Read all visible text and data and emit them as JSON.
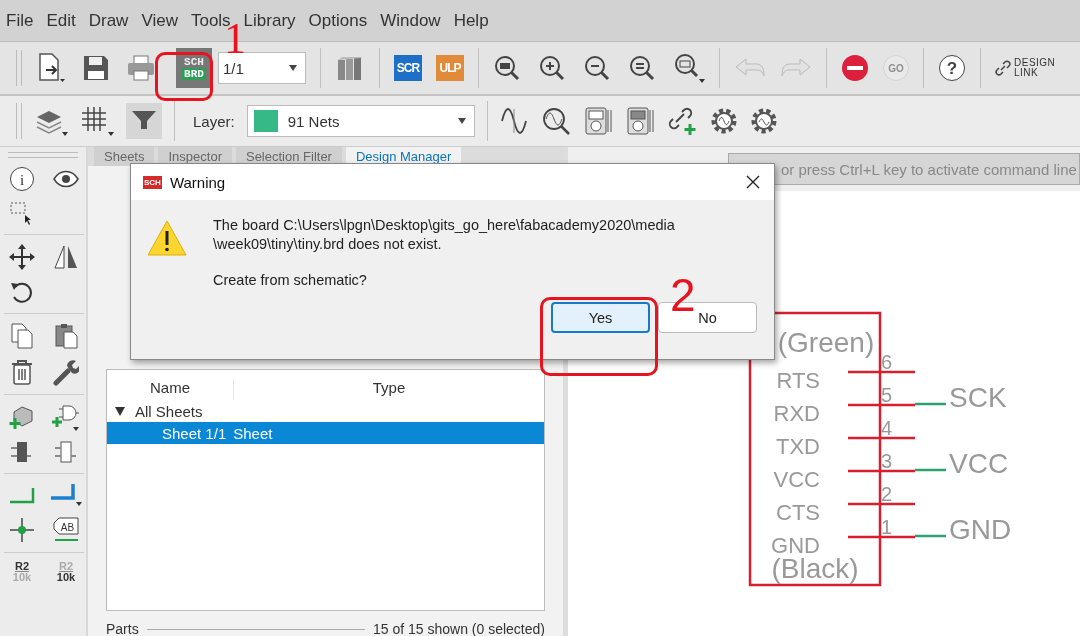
{
  "menu": [
    "File",
    "Edit",
    "Draw",
    "View",
    "Tools",
    "Library",
    "Options",
    "Window",
    "Help"
  ],
  "toolbar": {
    "switch_top": "SCH",
    "switch_bottom": "BRD",
    "sheet_select": "1/1",
    "script_label": "SCR",
    "ulp_label": "ULP",
    "undo_disabled": true,
    "redo_disabled": true,
    "go_label": "GO",
    "go_disabled": true,
    "help_glyph": "?",
    "design_link": "DESIGN\nLINK"
  },
  "toolbar2": {
    "filter_on": true,
    "layer_label": "Layer:",
    "layer_value": "91 Nets"
  },
  "palette": {
    "info_glyph": "i",
    "label_tool": "AB",
    "name_tool": {
      "top": "R2",
      "bottom": "10k"
    },
    "value_tool": {
      "top": "R2",
      "bottom": "10k"
    }
  },
  "panel": {
    "tabs": [
      {
        "label": "Sheets",
        "selected": false
      },
      {
        "label": "Inspector",
        "selected": false
      },
      {
        "label": "Selection Filter",
        "selected": false
      },
      {
        "label": "Design Manager",
        "selected": true
      }
    ],
    "columns": [
      "Name",
      "Type"
    ],
    "groups": [
      {
        "label": "All Sheets",
        "expanded": true,
        "children": [
          {
            "name": "Sheet 1/1",
            "type": "Sheet",
            "selected": true
          }
        ]
      }
    ],
    "footer_label": "Parts",
    "footer_summary": "15 of 15 shown (0 selected)"
  },
  "command_line": {
    "placeholder": "or press Ctrl+L key to activate command line"
  },
  "schematic": {
    "top_label": "(Green)",
    "bottom_label": "(Black)",
    "pins": [
      {
        "number": "6",
        "name": "RTS"
      },
      {
        "number": "5",
        "name": "RXD",
        "net": "SCK"
      },
      {
        "number": "4",
        "name": "TXD"
      },
      {
        "number": "3",
        "name": "VCC",
        "net": "VCC"
      },
      {
        "number": "2",
        "name": "CTS"
      },
      {
        "number": "1",
        "name": "GND",
        "net": "GND"
      }
    ]
  },
  "dialog": {
    "icon_label": "SCH",
    "title": "Warning",
    "message": "The board C:\\Users\\lpgn\\Desktop\\gits_go_here\\fabacademy2020\\media\n\\week09\\tiny\\tiny.brd does not exist.",
    "question": "Create from schematic?",
    "buttons": [
      {
        "label": "Yes",
        "default": true
      },
      {
        "label": "No",
        "default": false
      }
    ]
  },
  "annotations": [
    {
      "label": "1",
      "kind": "toolbar"
    },
    {
      "label": "2",
      "kind": "dialog"
    }
  ]
}
